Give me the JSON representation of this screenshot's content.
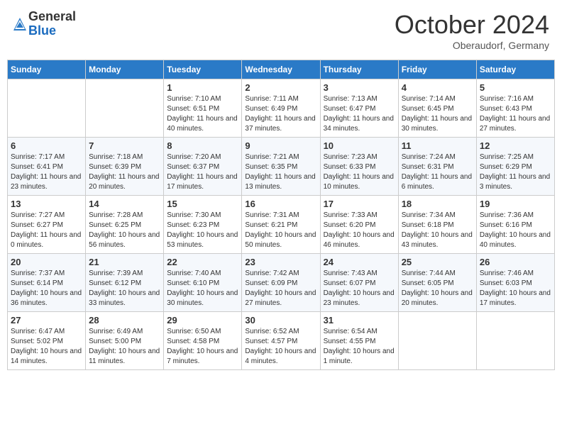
{
  "header": {
    "logo_general": "General",
    "logo_blue": "Blue",
    "month_title": "October 2024",
    "location": "Oberaudorf, Germany"
  },
  "weekdays": [
    "Sunday",
    "Monday",
    "Tuesday",
    "Wednesday",
    "Thursday",
    "Friday",
    "Saturday"
  ],
  "weeks": [
    [
      {
        "day": "",
        "info": ""
      },
      {
        "day": "",
        "info": ""
      },
      {
        "day": "1",
        "info": "Sunrise: 7:10 AM\nSunset: 6:51 PM\nDaylight: 11 hours and 40 minutes."
      },
      {
        "day": "2",
        "info": "Sunrise: 7:11 AM\nSunset: 6:49 PM\nDaylight: 11 hours and 37 minutes."
      },
      {
        "day": "3",
        "info": "Sunrise: 7:13 AM\nSunset: 6:47 PM\nDaylight: 11 hours and 34 minutes."
      },
      {
        "day": "4",
        "info": "Sunrise: 7:14 AM\nSunset: 6:45 PM\nDaylight: 11 hours and 30 minutes."
      },
      {
        "day": "5",
        "info": "Sunrise: 7:16 AM\nSunset: 6:43 PM\nDaylight: 11 hours and 27 minutes."
      }
    ],
    [
      {
        "day": "6",
        "info": "Sunrise: 7:17 AM\nSunset: 6:41 PM\nDaylight: 11 hours and 23 minutes."
      },
      {
        "day": "7",
        "info": "Sunrise: 7:18 AM\nSunset: 6:39 PM\nDaylight: 11 hours and 20 minutes."
      },
      {
        "day": "8",
        "info": "Sunrise: 7:20 AM\nSunset: 6:37 PM\nDaylight: 11 hours and 17 minutes."
      },
      {
        "day": "9",
        "info": "Sunrise: 7:21 AM\nSunset: 6:35 PM\nDaylight: 11 hours and 13 minutes."
      },
      {
        "day": "10",
        "info": "Sunrise: 7:23 AM\nSunset: 6:33 PM\nDaylight: 11 hours and 10 minutes."
      },
      {
        "day": "11",
        "info": "Sunrise: 7:24 AM\nSunset: 6:31 PM\nDaylight: 11 hours and 6 minutes."
      },
      {
        "day": "12",
        "info": "Sunrise: 7:25 AM\nSunset: 6:29 PM\nDaylight: 11 hours and 3 minutes."
      }
    ],
    [
      {
        "day": "13",
        "info": "Sunrise: 7:27 AM\nSunset: 6:27 PM\nDaylight: 11 hours and 0 minutes."
      },
      {
        "day": "14",
        "info": "Sunrise: 7:28 AM\nSunset: 6:25 PM\nDaylight: 10 hours and 56 minutes."
      },
      {
        "day": "15",
        "info": "Sunrise: 7:30 AM\nSunset: 6:23 PM\nDaylight: 10 hours and 53 minutes."
      },
      {
        "day": "16",
        "info": "Sunrise: 7:31 AM\nSunset: 6:21 PM\nDaylight: 10 hours and 50 minutes."
      },
      {
        "day": "17",
        "info": "Sunrise: 7:33 AM\nSunset: 6:20 PM\nDaylight: 10 hours and 46 minutes."
      },
      {
        "day": "18",
        "info": "Sunrise: 7:34 AM\nSunset: 6:18 PM\nDaylight: 10 hours and 43 minutes."
      },
      {
        "day": "19",
        "info": "Sunrise: 7:36 AM\nSunset: 6:16 PM\nDaylight: 10 hours and 40 minutes."
      }
    ],
    [
      {
        "day": "20",
        "info": "Sunrise: 7:37 AM\nSunset: 6:14 PM\nDaylight: 10 hours and 36 minutes."
      },
      {
        "day": "21",
        "info": "Sunrise: 7:39 AM\nSunset: 6:12 PM\nDaylight: 10 hours and 33 minutes."
      },
      {
        "day": "22",
        "info": "Sunrise: 7:40 AM\nSunset: 6:10 PM\nDaylight: 10 hours and 30 minutes."
      },
      {
        "day": "23",
        "info": "Sunrise: 7:42 AM\nSunset: 6:09 PM\nDaylight: 10 hours and 27 minutes."
      },
      {
        "day": "24",
        "info": "Sunrise: 7:43 AM\nSunset: 6:07 PM\nDaylight: 10 hours and 23 minutes."
      },
      {
        "day": "25",
        "info": "Sunrise: 7:44 AM\nSunset: 6:05 PM\nDaylight: 10 hours and 20 minutes."
      },
      {
        "day": "26",
        "info": "Sunrise: 7:46 AM\nSunset: 6:03 PM\nDaylight: 10 hours and 17 minutes."
      }
    ],
    [
      {
        "day": "27",
        "info": "Sunrise: 6:47 AM\nSunset: 5:02 PM\nDaylight: 10 hours and 14 minutes."
      },
      {
        "day": "28",
        "info": "Sunrise: 6:49 AM\nSunset: 5:00 PM\nDaylight: 10 hours and 11 minutes."
      },
      {
        "day": "29",
        "info": "Sunrise: 6:50 AM\nSunset: 4:58 PM\nDaylight: 10 hours and 7 minutes."
      },
      {
        "day": "30",
        "info": "Sunrise: 6:52 AM\nSunset: 4:57 PM\nDaylight: 10 hours and 4 minutes."
      },
      {
        "day": "31",
        "info": "Sunrise: 6:54 AM\nSunset: 4:55 PM\nDaylight: 10 hours and 1 minute."
      },
      {
        "day": "",
        "info": ""
      },
      {
        "day": "",
        "info": ""
      }
    ]
  ]
}
